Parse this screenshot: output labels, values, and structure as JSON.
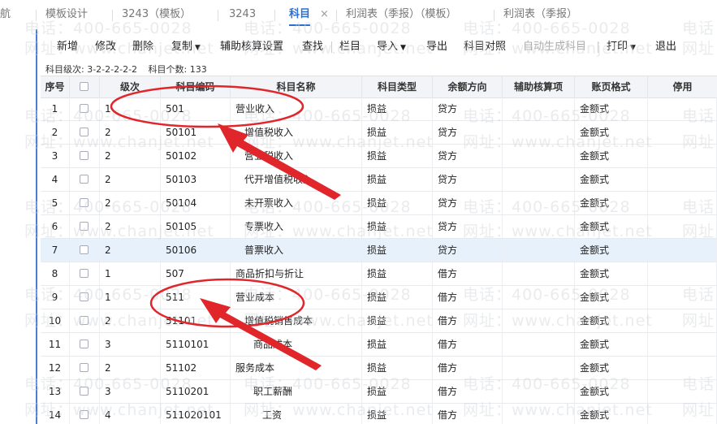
{
  "tabs": [
    {
      "label": "航",
      "active": false
    },
    {
      "label": "模板设计",
      "active": false
    },
    {
      "label": "3243（模板）",
      "active": false
    },
    {
      "label": "3243",
      "active": false
    },
    {
      "label": "科目",
      "active": true
    },
    {
      "label": "利润表（季报）（模板）",
      "active": false
    },
    {
      "label": "利润表（季报）",
      "active": false
    }
  ],
  "tab_close": "×",
  "toolbar": [
    {
      "label": "新增",
      "dropdown": false,
      "disabled": false
    },
    {
      "label": "修改",
      "dropdown": false,
      "disabled": false
    },
    {
      "label": "删除",
      "dropdown": false,
      "disabled": false
    },
    {
      "label": "复制",
      "dropdown": true,
      "disabled": false
    },
    {
      "label": "辅助核算设置",
      "dropdown": false,
      "disabled": false
    },
    {
      "label": "查找",
      "dropdown": false,
      "disabled": false
    },
    {
      "label": "栏目",
      "dropdown": false,
      "disabled": false
    },
    {
      "label": "导入",
      "dropdown": true,
      "disabled": false
    },
    {
      "label": "导出",
      "dropdown": false,
      "disabled": false
    },
    {
      "label": "科目对照",
      "dropdown": false,
      "disabled": false
    },
    {
      "label": "自动生成科目",
      "dropdown": false,
      "disabled": true
    },
    {
      "label": "打印",
      "dropdown": true,
      "disabled": false
    },
    {
      "label": "退出",
      "dropdown": false,
      "disabled": false
    }
  ],
  "info": {
    "levels": "科目级次:  3-2-2-2-2-2",
    "count": "科目个数:   133"
  },
  "columns": [
    "序号",
    "",
    "级次",
    "科目编码",
    "科目名称",
    "科目类型",
    "余额方向",
    "辅助核算项",
    "账页格式",
    "停用"
  ],
  "rows": [
    {
      "seq": "1",
      "level": "1",
      "code": "501",
      "name": "营业收入",
      "indent": 0,
      "type": "损益",
      "dir": "贷方",
      "aux": "",
      "fmt": "金额式",
      "stop": "",
      "hl": false
    },
    {
      "seq": "2",
      "level": "2",
      "code": "50101",
      "name": "增值税收入",
      "indent": 1,
      "type": "损益",
      "dir": "贷方",
      "aux": "",
      "fmt": "金额式",
      "stop": "",
      "hl": false
    },
    {
      "seq": "3",
      "level": "2",
      "code": "50102",
      "name": "营业税收入",
      "indent": 1,
      "type": "损益",
      "dir": "贷方",
      "aux": "",
      "fmt": "金额式",
      "stop": "",
      "hl": false
    },
    {
      "seq": "4",
      "level": "2",
      "code": "50103",
      "name": "代开增值税收入",
      "indent": 1,
      "type": "损益",
      "dir": "贷方",
      "aux": "",
      "fmt": "金额式",
      "stop": "",
      "hl": false
    },
    {
      "seq": "5",
      "level": "2",
      "code": "50104",
      "name": "未开票收入",
      "indent": 1,
      "type": "损益",
      "dir": "贷方",
      "aux": "",
      "fmt": "金额式",
      "stop": "",
      "hl": false
    },
    {
      "seq": "6",
      "level": "2",
      "code": "50105",
      "name": "专票收入",
      "indent": 1,
      "type": "损益",
      "dir": "贷方",
      "aux": "",
      "fmt": "金额式",
      "stop": "",
      "hl": false
    },
    {
      "seq": "7",
      "level": "2",
      "code": "50106",
      "name": "普票收入",
      "indent": 1,
      "type": "损益",
      "dir": "贷方",
      "aux": "",
      "fmt": "金额式",
      "stop": "",
      "hl": true
    },
    {
      "seq": "8",
      "level": "1",
      "code": "507",
      "name": "商品折扣与折让",
      "indent": 0,
      "type": "损益",
      "dir": "借方",
      "aux": "",
      "fmt": "金额式",
      "stop": "",
      "hl": false
    },
    {
      "seq": "9",
      "level": "1",
      "code": "511",
      "name": "营业成本",
      "indent": 0,
      "type": "损益",
      "dir": "借方",
      "aux": "",
      "fmt": "金额式",
      "stop": "",
      "hl": false
    },
    {
      "seq": "10",
      "level": "2",
      "code": "51101",
      "name": "增值税销售成本",
      "indent": 1,
      "type": "损益",
      "dir": "借方",
      "aux": "",
      "fmt": "金额式",
      "stop": "",
      "hl": false
    },
    {
      "seq": "11",
      "level": "3",
      "code": "5110101",
      "name": "商品成本",
      "indent": 2,
      "type": "损益",
      "dir": "借方",
      "aux": "",
      "fmt": "金额式",
      "stop": "",
      "hl": false
    },
    {
      "seq": "12",
      "level": "2",
      "code": "51102",
      "name": "服务成本",
      "indent": 0,
      "type": "损益",
      "dir": "借方",
      "aux": "",
      "fmt": "金额式",
      "stop": "",
      "hl": false
    },
    {
      "seq": "13",
      "level": "3",
      "code": "5110201",
      "name": "职工薪酬",
      "indent": 2,
      "type": "损益",
      "dir": "借方",
      "aux": "",
      "fmt": "金额式",
      "stop": "",
      "hl": false
    },
    {
      "seq": "14",
      "level": "4",
      "code": "511020101",
      "name": "工资",
      "indent": 3,
      "type": "损益",
      "dir": "借方",
      "aux": "",
      "fmt": "金额式",
      "stop": "",
      "hl": false
    }
  ],
  "watermarks": {
    "phone": "电话：400-665-0028",
    "site": "网址：www.chanjet.net"
  },
  "colors": {
    "accent": "#2c6fd0",
    "annotation": "#e0262b",
    "highlight_row": "#e7f1fb"
  }
}
